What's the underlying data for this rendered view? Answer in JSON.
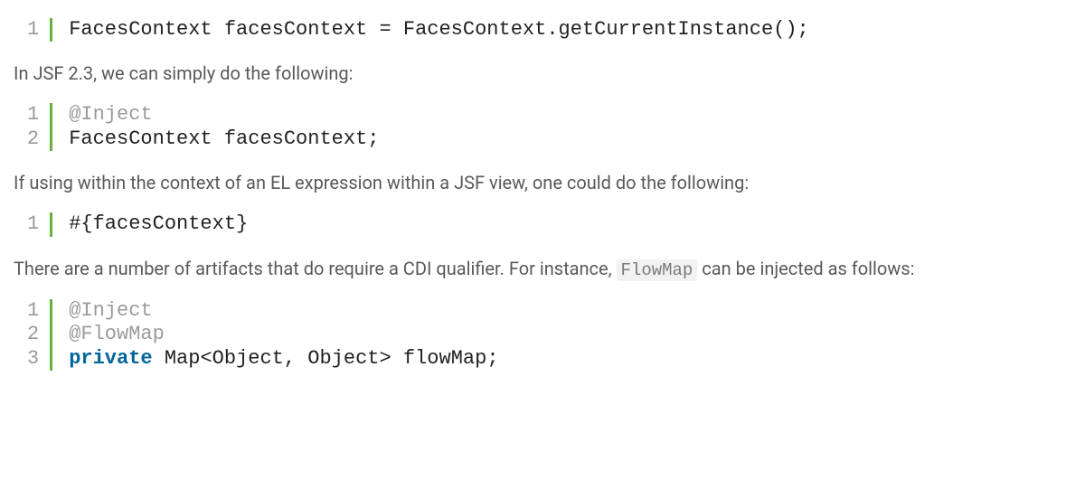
{
  "block1": {
    "lines": "1",
    "l1_a": "FacesContext facesContext ",
    "l1_b": "=",
    "l1_c": " FacesContext",
    "l1_d": ".",
    "l1_e": "getCurrentInstance",
    "l1_f": "();"
  },
  "para1": "In JSF 2.3, we can simply do the following:",
  "block2": {
    "lines": "1\n2",
    "l1": "@Inject",
    "l2": "FacesContext facesContext",
    "l2_semi": ";"
  },
  "para2": "If using within the context of an EL expression within a JSF view, one could do the following:",
  "block3": {
    "lines": "1",
    "l1_a": "#{facesContext}"
  },
  "para3_a": "There are a number of artifacts that do require a CDI qualifier.  For instance, ",
  "para3_code": "FlowMap",
  "para3_b": " can be injected as follows:",
  "block4": {
    "lines": "1\n2\n3",
    "l1": "@Inject",
    "l2": "@FlowMap",
    "l3_a": "private",
    "l3_b": " Map",
    "l3_c": "<",
    "l3_d": "Object",
    "l3_e": ",",
    "l3_f": " Object",
    "l3_g": ">",
    "l3_h": " flowMap",
    "l3_i": ";"
  }
}
